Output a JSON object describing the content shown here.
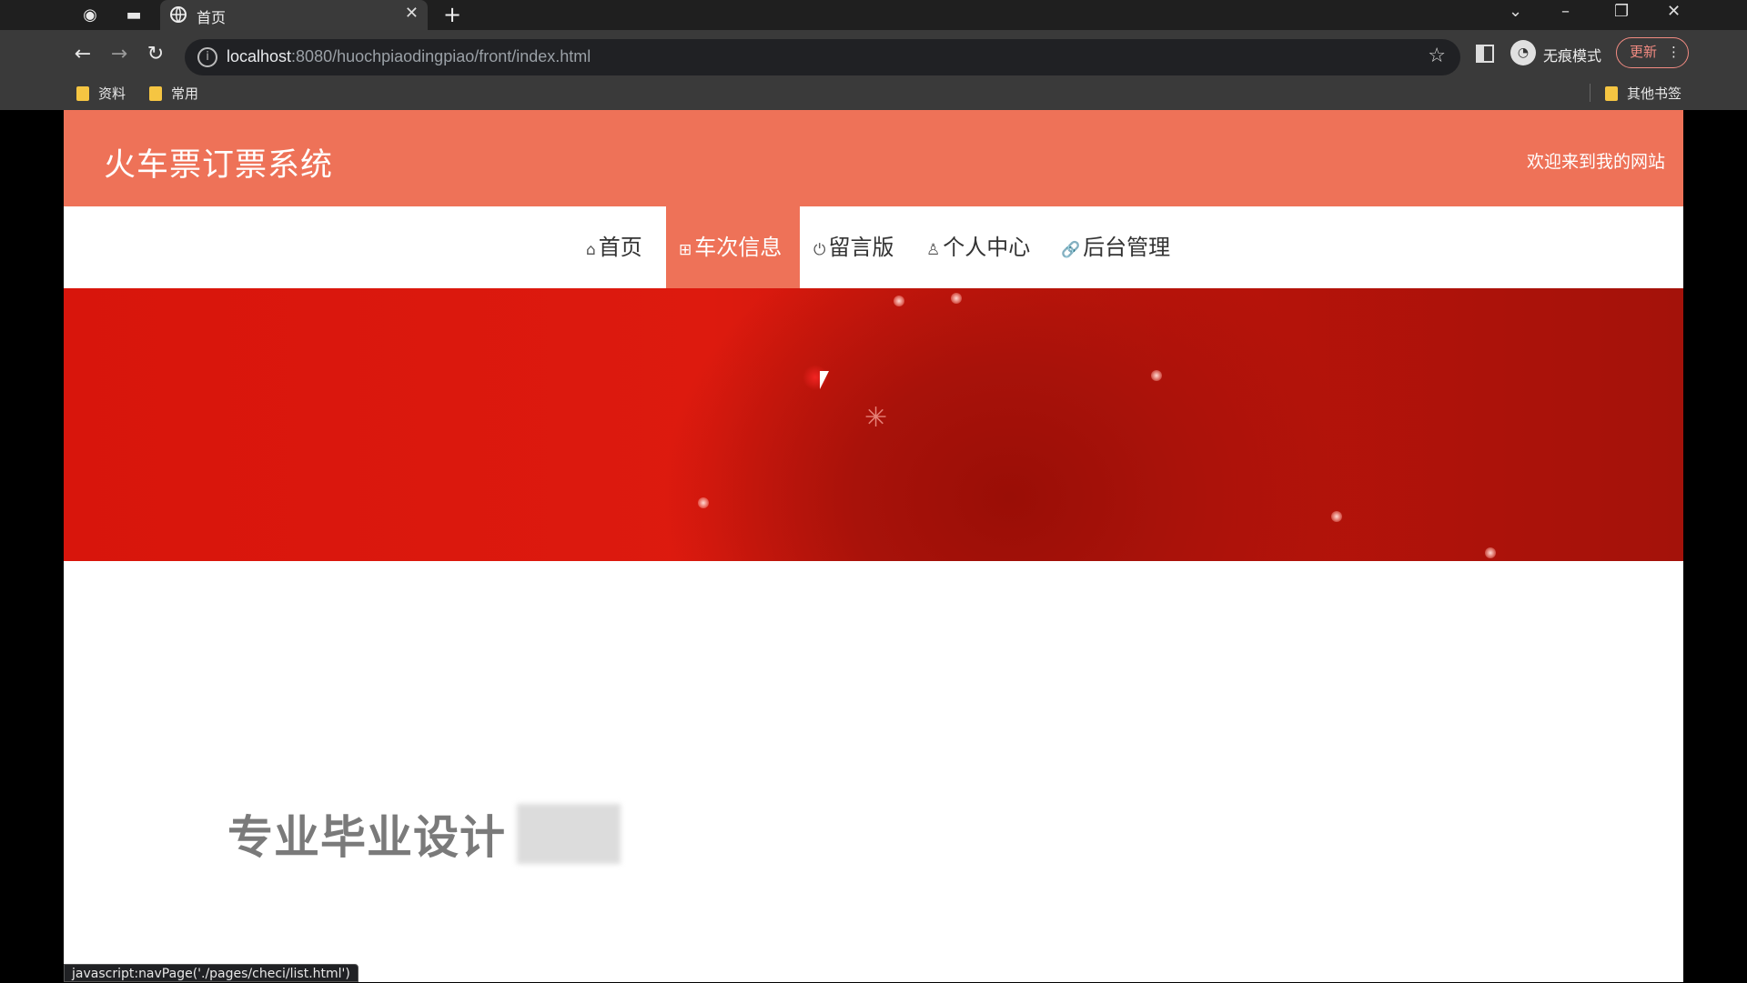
{
  "browser": {
    "tab_title": "首页",
    "url_host": "localhost",
    "url_rest": ":8080/huochpiaodingpiao/front/index.html",
    "incognito_label": "无痕模式",
    "update_label": "更新",
    "bookmarks": [
      {
        "label": "资料"
      },
      {
        "label": "常用"
      },
      {
        "label": "其他书签"
      }
    ],
    "status_text": "javascript:navPage('./pages/checi/list.html')"
  },
  "site": {
    "title": "火车票订票系统",
    "welcome": "欢迎来到我的网站",
    "nav": [
      {
        "label": "首页",
        "icon": "home-icon"
      },
      {
        "label": "车次信息",
        "icon": "grid-icon",
        "active": true
      },
      {
        "label": "留言版",
        "icon": "power-icon"
      },
      {
        "label": "个人中心",
        "icon": "user-icon"
      },
      {
        "label": "后台管理",
        "icon": "link-icon"
      }
    ],
    "tagline": "专业毕业设计"
  },
  "colors": {
    "brand": "#ee7258",
    "banner": "#d8150c"
  }
}
